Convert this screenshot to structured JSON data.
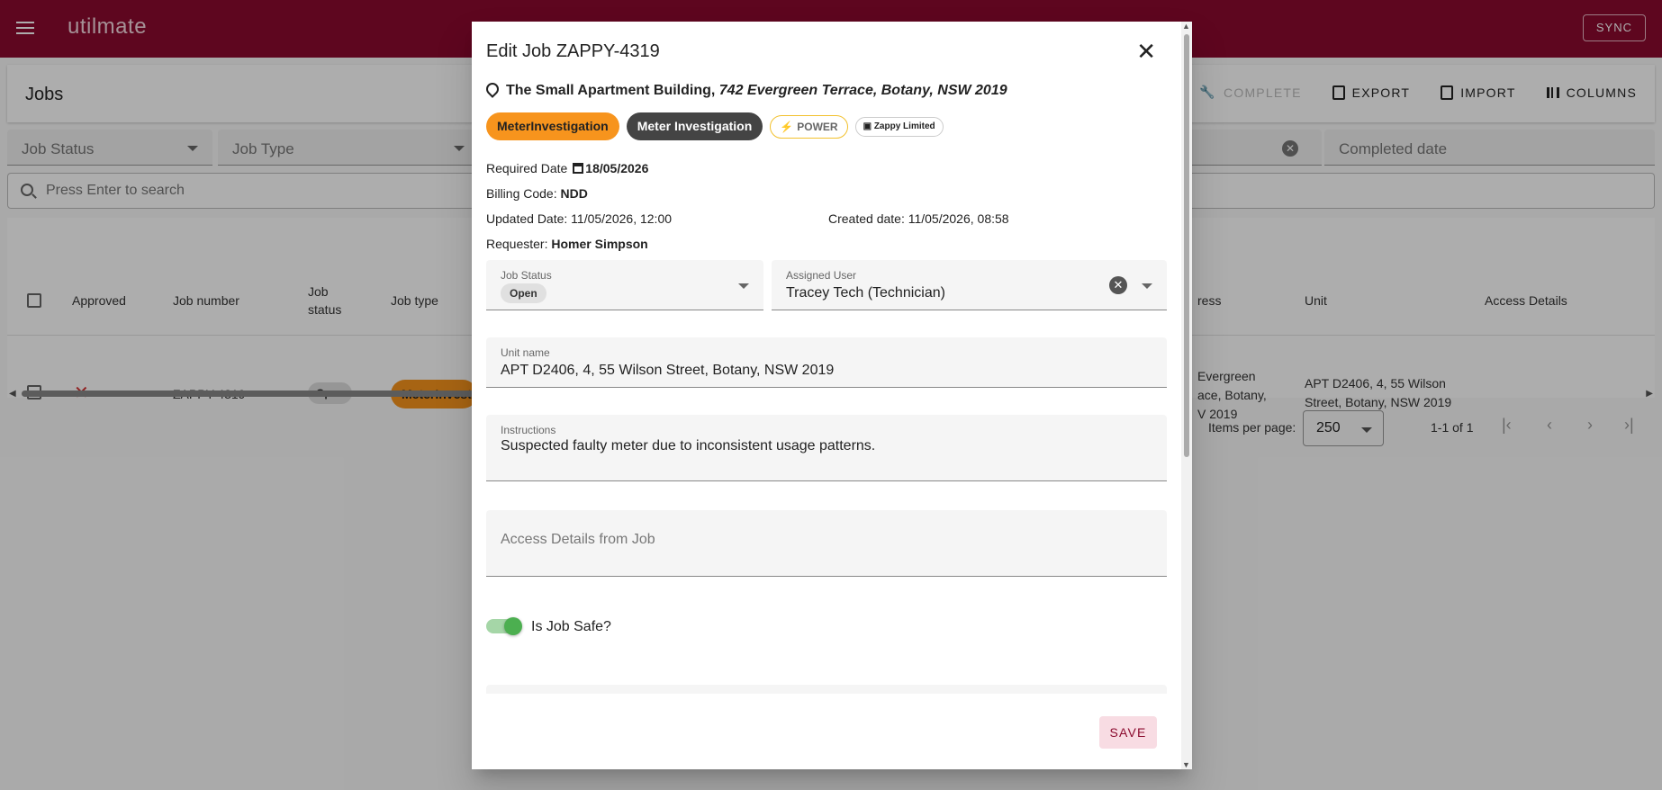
{
  "app": {
    "logo": "utilmate",
    "sync_label": "SYNC"
  },
  "jobs_page": {
    "title": "Jobs",
    "actions": {
      "complete": "COMPLETE",
      "export": "EXPORT",
      "import": "IMPORT",
      "columns": "COLUMNS"
    },
    "filters": {
      "job_status": "Job Status",
      "job_type": "Job Type",
      "completed_date": "Completed date"
    },
    "search_placeholder": "Press Enter to search",
    "columns": {
      "approved": "Approved",
      "job_number": "Job number",
      "job_status_1": "Job",
      "job_status_2": "status",
      "job_type": "Job type",
      "address": "ress",
      "unit": "Unit",
      "access_details": "Access Details"
    },
    "row": {
      "job_number": "ZAPPY-4319",
      "status": "Open",
      "job_type": "MeterInvestigation",
      "address_1": "Evergreen",
      "address_2": "ace, Botany,",
      "address_3": "V 2019",
      "unit_1": "APT D2406, 4, 55 Wilson",
      "unit_2": "Street, Botany, NSW 2019"
    },
    "pagination": {
      "items_per_page_label": "Items per page:",
      "items_per_page_value": "250",
      "range": "1-1 of 1"
    }
  },
  "dialog": {
    "title": "Edit Job ZAPPY-4319",
    "building": "The Small Apartment Building,",
    "address": "742 Evergreen Terrace, Botany, NSW 2019",
    "chips": {
      "type_code": "MeterInvestigation",
      "type_name": "Meter Investigation",
      "utility": "POWER",
      "company": "Zappy Limited"
    },
    "required_date_label": "Required Date",
    "required_date": "18/05/2026",
    "billing_code_label": "Billing Code:",
    "billing_code": "NDD",
    "updated_date": "Updated Date: 11/05/2026, 12:00",
    "created_date": "Created date: 11/05/2026, 08:58",
    "requester_label": "Requester:",
    "requester": "Homer Simpson",
    "job_status_label": "Job Status",
    "job_status_value": "Open",
    "assigned_user_label": "Assigned User",
    "assigned_user_value": "Tracey Tech (Technician)",
    "unit_name_label": "Unit name",
    "unit_name_value": "APT D2406, 4, 55 Wilson Street, Botany, NSW 2019",
    "instructions_label": "Instructions",
    "instructions_value": "Suspected faulty meter due to inconsistent usage patterns.",
    "access_details_placeholder": "Access Details from Job",
    "is_job_safe_label": "Is Job Safe?",
    "is_job_safe": true,
    "save_label": "SAVE"
  },
  "colors": {
    "brand": "#8b0a2e",
    "chip_orange": "#f7941d",
    "chip_dark": "#444444",
    "toggle_on": "#4caf50"
  }
}
